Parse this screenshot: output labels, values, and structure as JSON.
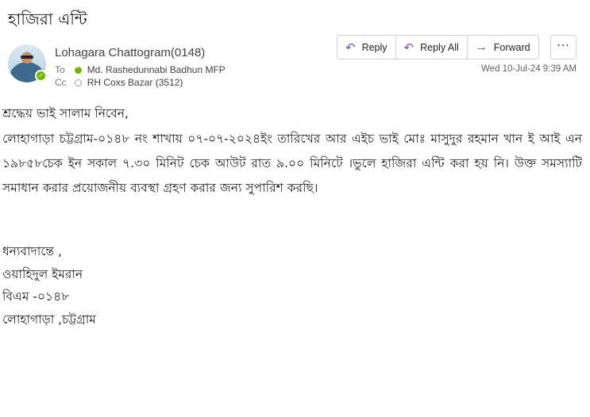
{
  "email": {
    "subject": "হাজিরা এন্টি",
    "sender": "Lohagara Chattogram(0148)",
    "to_label": "To",
    "to_name": "Md. Rashedunnabi Badhun MFP",
    "cc_label": "Cc",
    "cc_name": "RH Coxs Bazar (3512)",
    "timestamp": "Wed 10-Jul-24 9:39 AM",
    "actions": {
      "reply": "Reply",
      "reply_all": "Reply All",
      "forward": "Forward",
      "more": "···"
    },
    "body": {
      "greeting": "শ্রদ্ধেয় ভাই সালাম নিবেন,",
      "paragraph": "লোহাগাড়া চট্টগ্রাম-০১৪৮ নং শাখায়  ০৭-০৭-২০২৪ইং তারিখের আর এইচ ভাই মোঃ মাসুদুর রহমান খান ই আই এন ১৯৮৫৮চেক ইন সকাল ৭.৩০ মিনিট চেক আউট রাত ৯.০০ মিনিটে  ।ভুলে হাজিরা এন্টি করা হয় নি। উক্ত সমস্যাটি সমাধান করার প্রয়োজনীয় ব্যবস্থা গ্রহণ করার জন্য সুপারিশ করছি।",
      "signature": [
        "ধন্যবাদান্তে ,",
        "ওয়াহিদুল ইমরান",
        "বিএম -০১৪৮",
        "লোহাগাড়া ,চট্টগ্রাম"
      ]
    }
  },
  "icons": {
    "reply": "reply-icon",
    "reply_all": "reply-all-icon",
    "forward": "forward-icon",
    "presence": "presence-available-icon"
  },
  "colors": {
    "presence_green": "#6bb700",
    "reply_accent": "#7d4fbf",
    "forward_accent": "#0f6cbd"
  }
}
